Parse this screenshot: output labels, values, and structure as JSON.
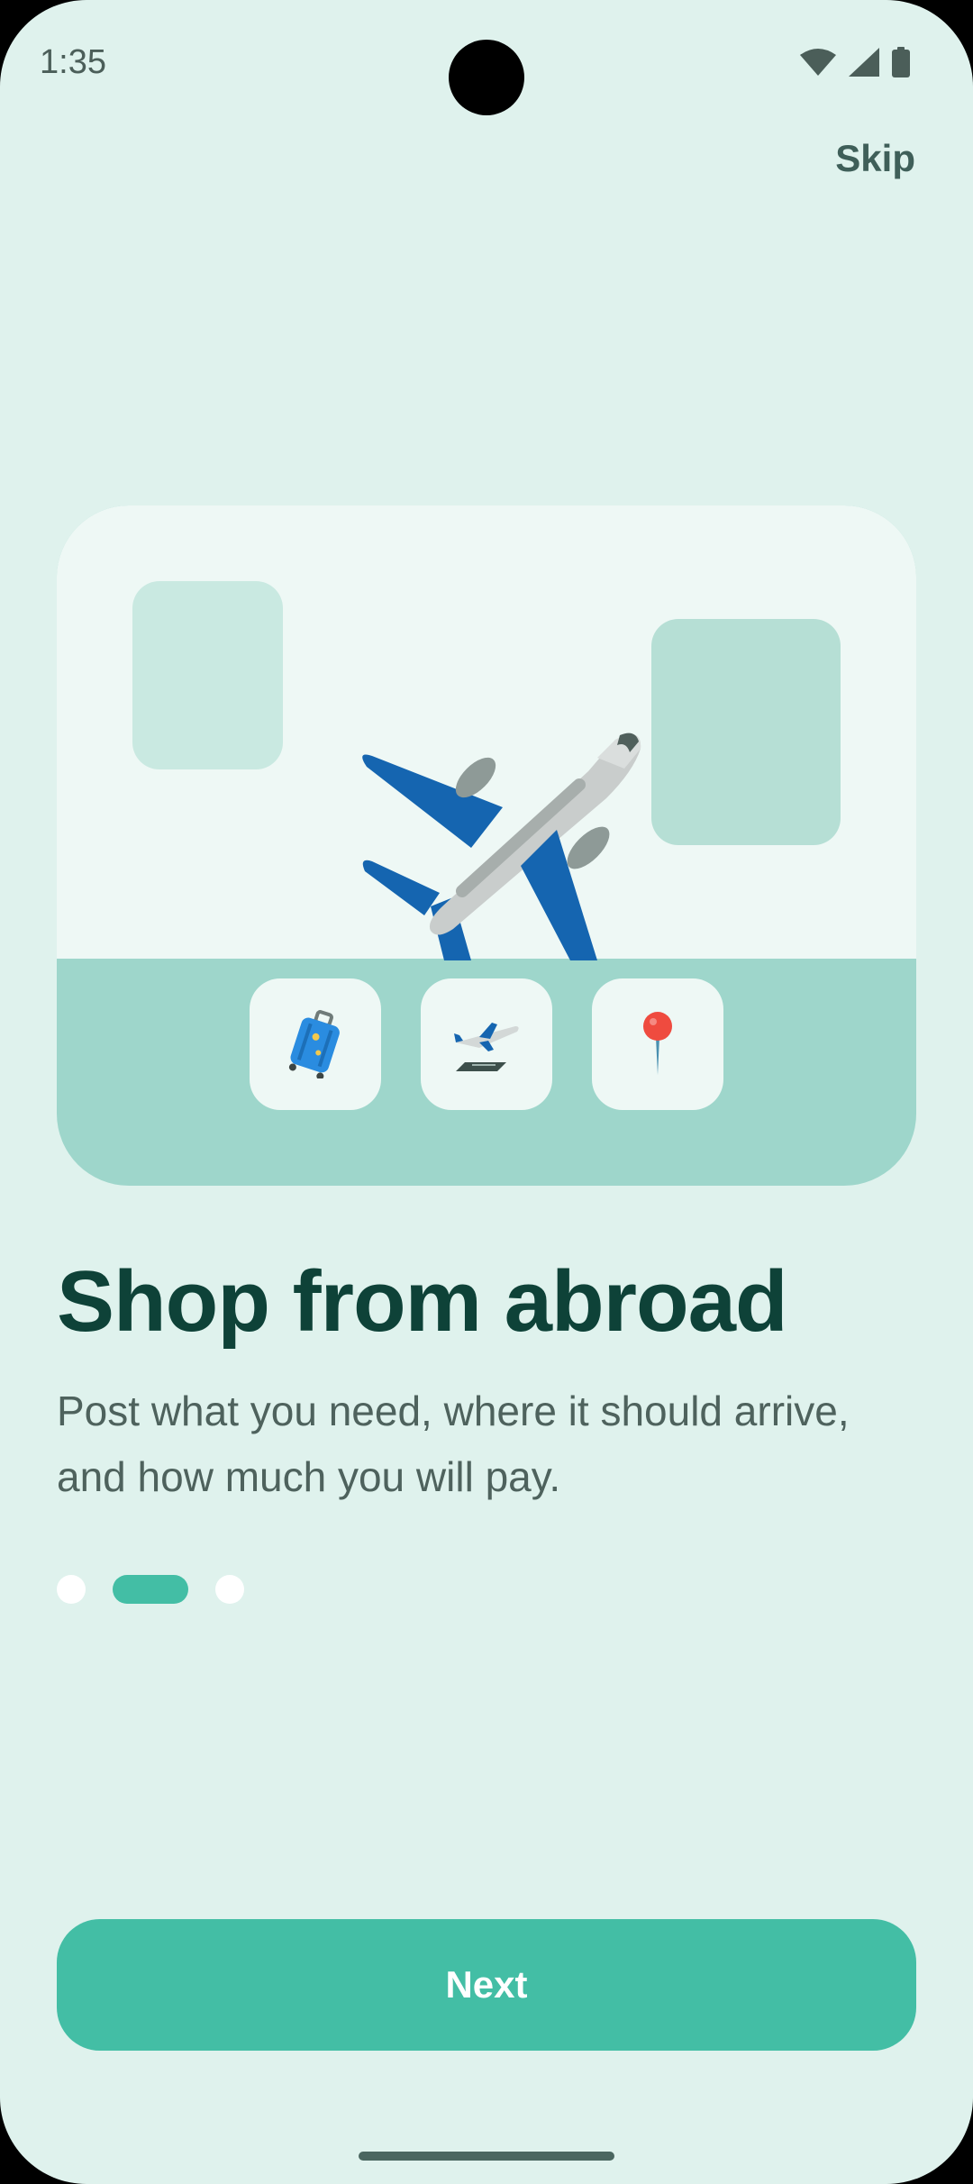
{
  "status_bar": {
    "time": "1:35",
    "icons": [
      "wifi-icon",
      "signal-icon",
      "battery-icon"
    ]
  },
  "header": {
    "skip_label": "Skip"
  },
  "hero": {
    "illustration": "airplane",
    "tiles": [
      "luggage-icon",
      "airplane-departure-icon",
      "location-pin-icon"
    ]
  },
  "content": {
    "title": "Shop from abroad",
    "description": "Post what you need, where it should arrive, and how much you will pay."
  },
  "pager": {
    "total_pages": 3,
    "current_page": 2
  },
  "footer": {
    "next_label": "Next"
  },
  "colors": {
    "background": "#DFF2ED",
    "accent": "#43BEA5",
    "title": "#0E4238",
    "body_text": "#4E625D"
  }
}
